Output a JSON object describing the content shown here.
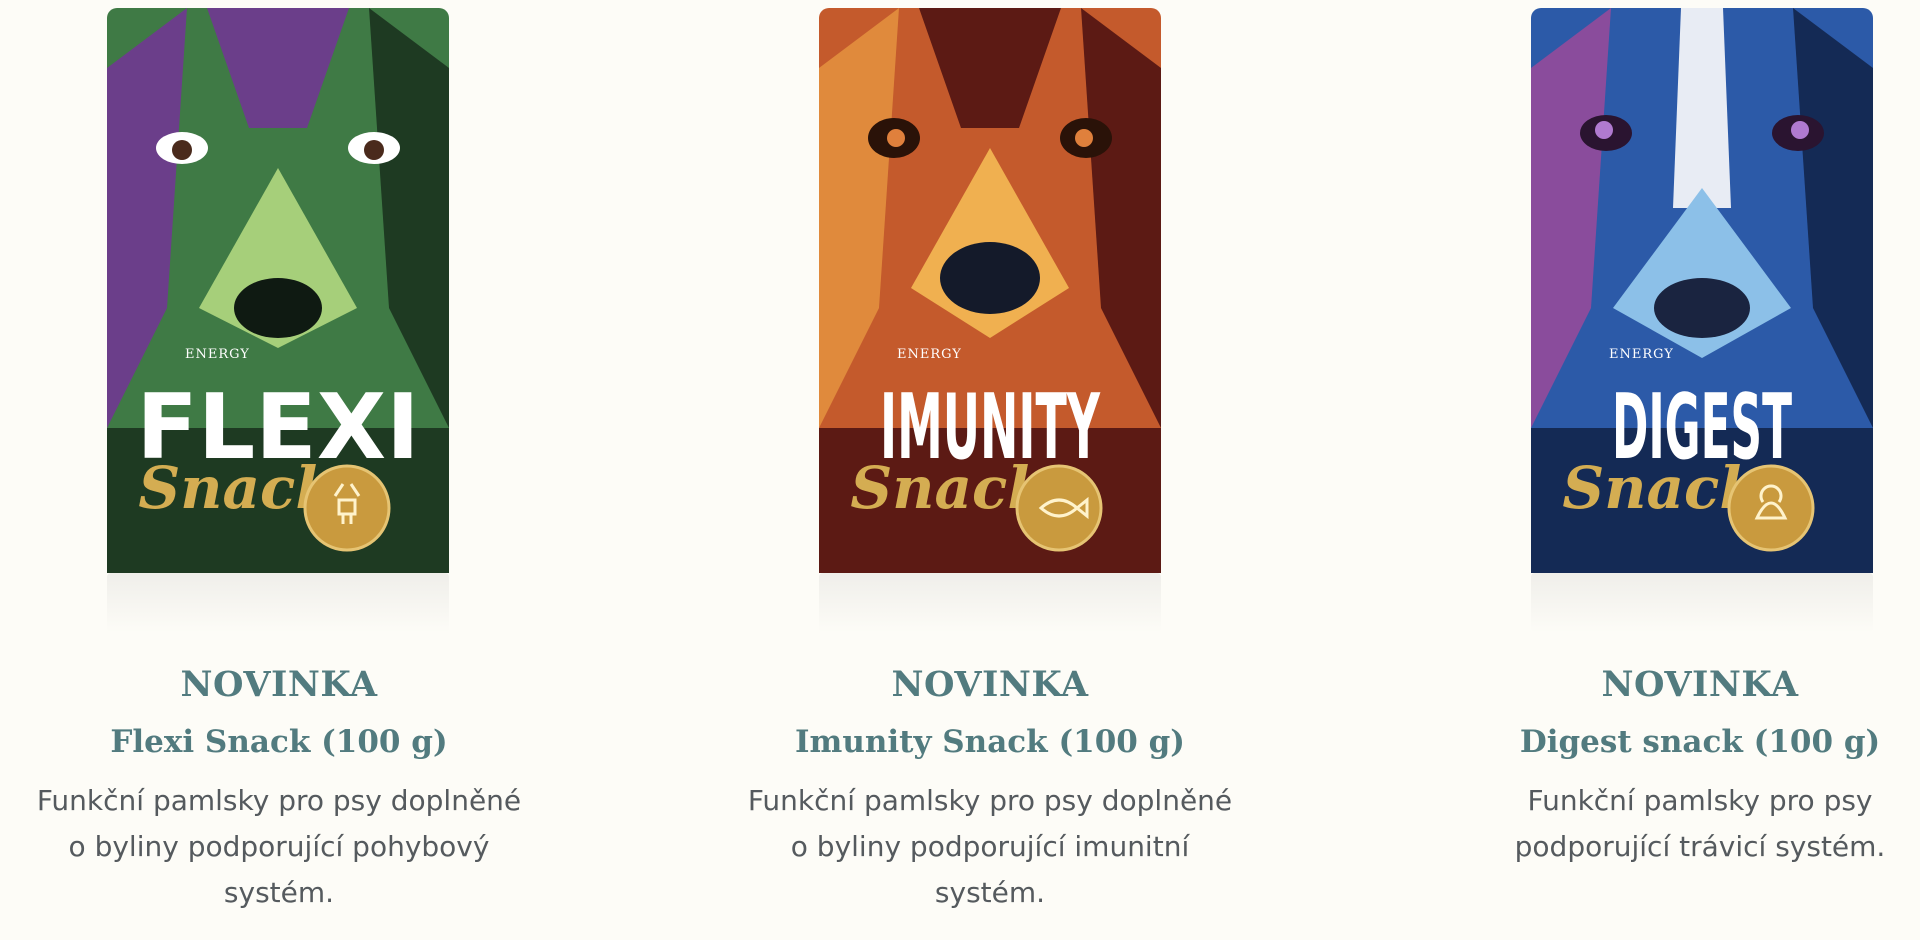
{
  "products": [
    {
      "badge": "NOVINKA",
      "title": "Flexi Snack (100 g)",
      "description": "Funkční pamlsky pro psy doplněné o byliny podporující pohybový systém.",
      "pack": {
        "brand": "ENERGY",
        "name": "FLEXI",
        "sub": "Snack",
        "seal_icon": "deer-icon",
        "colors": {
          "main": "#3f7a45",
          "dark": "#1e3a22",
          "accent": "#6b3e8a",
          "light": "#a6cf7a"
        }
      }
    },
    {
      "badge": "NOVINKA",
      "title": "Imunity Snack (100 g)",
      "description": "Funkční pamlsky pro psy doplněné o byliny podporující imunitní systém.",
      "pack": {
        "brand": "ENERGY",
        "name": "IMUNITY",
        "sub": "Snack",
        "seal_icon": "fish-icon",
        "colors": {
          "main": "#c45a2c",
          "dark": "#5c1a14",
          "accent": "#e08a3c",
          "light": "#f0b050"
        }
      }
    },
    {
      "badge": "NOVINKA",
      "title": "Digest snack (100 g)",
      "description": "Funkční pamlsky pro psy podporující trávicí systém.",
      "pack": {
        "brand": "ENERGY",
        "name": "DIGEST",
        "sub": "Snack",
        "seal_icon": "turkey-icon",
        "colors": {
          "main": "#2c5aa8",
          "dark": "#142a55",
          "accent": "#8a4c9c",
          "light": "#8cc0e8"
        }
      }
    }
  ]
}
